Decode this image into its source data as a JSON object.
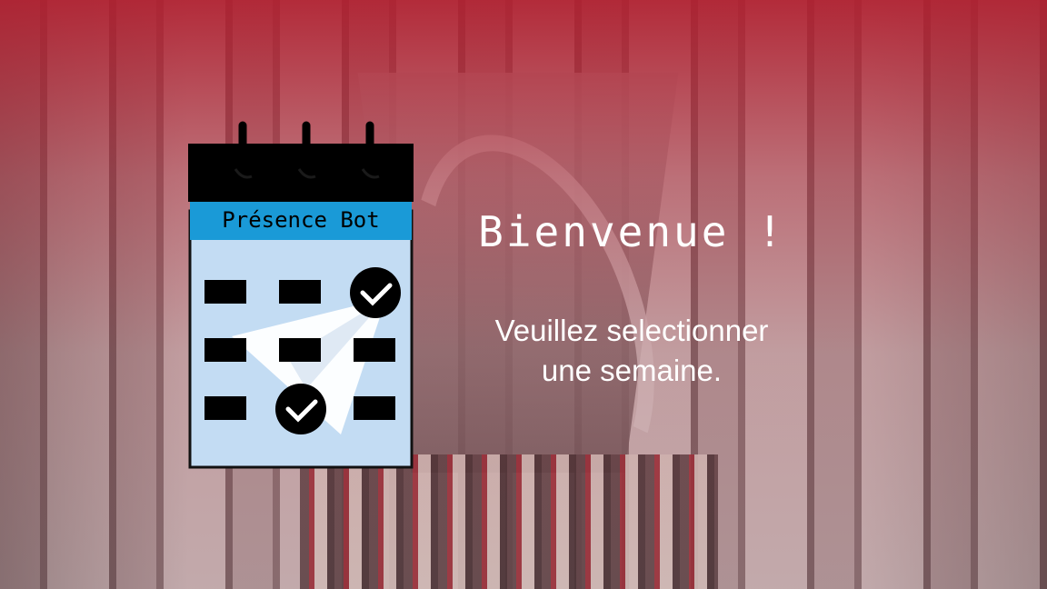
{
  "logo": {
    "title": "Présence Bot",
    "colors": {
      "header": "#000000",
      "band": "#1a9ad7",
      "body": "#c3dcf3",
      "mark": "#000000",
      "plane": "#ffffff"
    },
    "icons": [
      "calendar-icon",
      "paper-plane-icon",
      "checkmark-icon"
    ]
  },
  "welcome": {
    "title": "Bienvenue !",
    "subtitle_line1": "Veuillez selectionner",
    "subtitle_line2": "une semaine."
  },
  "theme": {
    "overlay_color": "#b01e2e"
  }
}
